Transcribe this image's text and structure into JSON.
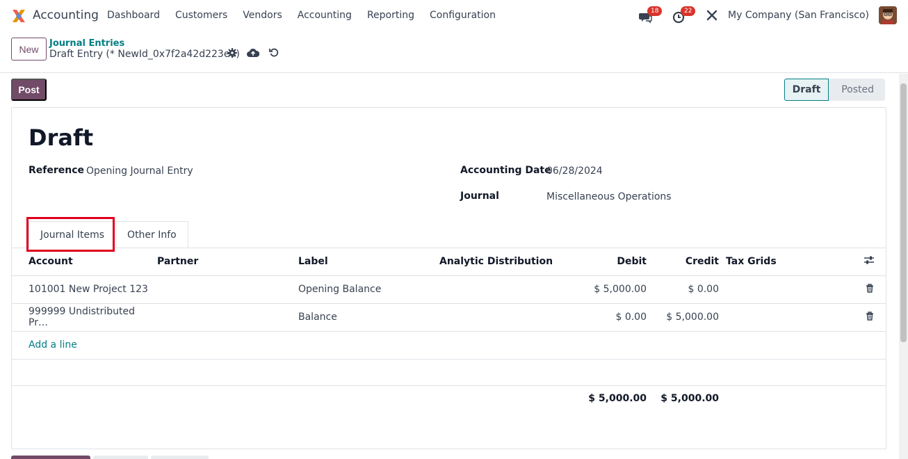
{
  "navbar": {
    "app_name": "Accounting",
    "menu": [
      "Dashboard",
      "Customers",
      "Vendors",
      "Accounting",
      "Reporting",
      "Configuration"
    ],
    "messages_count": "18",
    "activities_count": "22",
    "company": "My Company (San Francisco)"
  },
  "control_panel": {
    "new_label": "New",
    "breadcrumb_parent": "Journal Entries",
    "breadcrumb_current": "Draft Entry (* NewId_0x7f2a42d223e0)"
  },
  "actions": {
    "post_label": "Post"
  },
  "statusbar": {
    "stages": [
      "Draft",
      "Posted"
    ],
    "active": "Draft"
  },
  "form": {
    "title": "Draft",
    "reference_label": "Reference",
    "reference_value": "Opening Journal Entry",
    "date_label": "Accounting Date",
    "date_value": "06/28/2024",
    "journal_label": "Journal",
    "journal_value": "Miscellaneous Operations"
  },
  "tabs": [
    "Journal Items",
    "Other Info"
  ],
  "table": {
    "headers": [
      "Account",
      "Partner",
      "Label",
      "Analytic Distribution",
      "Debit",
      "Credit",
      "Tax Grids"
    ],
    "rows": [
      {
        "account": "101001 New Project 123",
        "partner": "",
        "label": "Opening Balance",
        "analytic": "",
        "debit": "$ 5,000.00",
        "credit": "$ 0.00"
      },
      {
        "account": "999999 Undistributed Pr…",
        "partner": "",
        "label": "Balance",
        "analytic": "",
        "debit": "$ 0.00",
        "credit": "$ 5,000.00"
      }
    ],
    "add_line": "Add a line",
    "total_debit": "$ 5,000.00",
    "total_credit": "$ 5,000.00"
  },
  "colors": {
    "brand": "#714b67",
    "accent": "#017e84",
    "highlight": "#e0001b",
    "badge": "#d9342b"
  }
}
